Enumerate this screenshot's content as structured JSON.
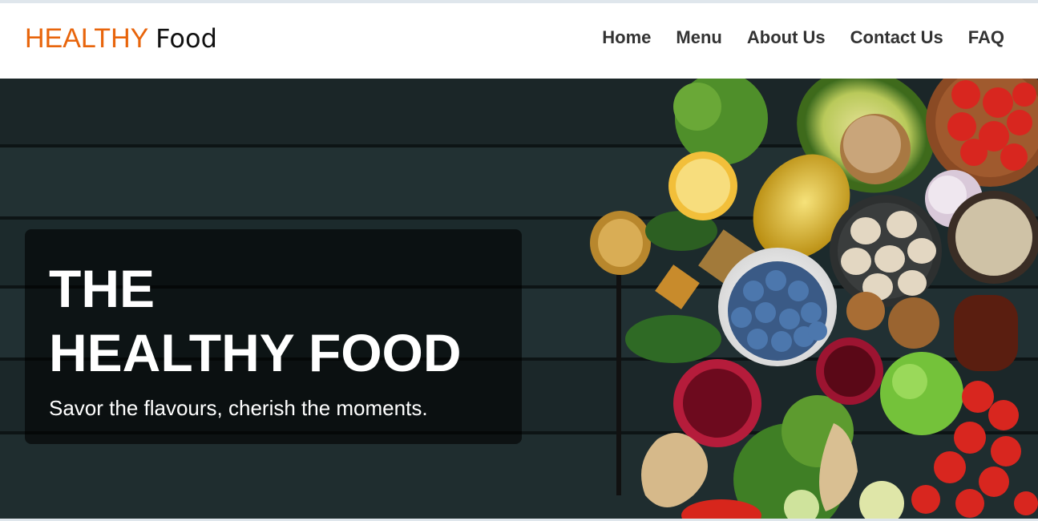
{
  "brand": {
    "part1": "HEALTHY",
    "part2": "Food",
    "accent_color": "#e8650c"
  },
  "nav": {
    "items": [
      "Home",
      "Menu",
      "About Us",
      "Contact Us",
      "FAQ"
    ]
  },
  "hero": {
    "title_line1": "THE",
    "title_line2": "HEALTHY FOOD",
    "tagline": "Savor the flavours, cherish the moments.",
    "image_subject": "healthy-food-ingredients-on-dark-wood"
  }
}
